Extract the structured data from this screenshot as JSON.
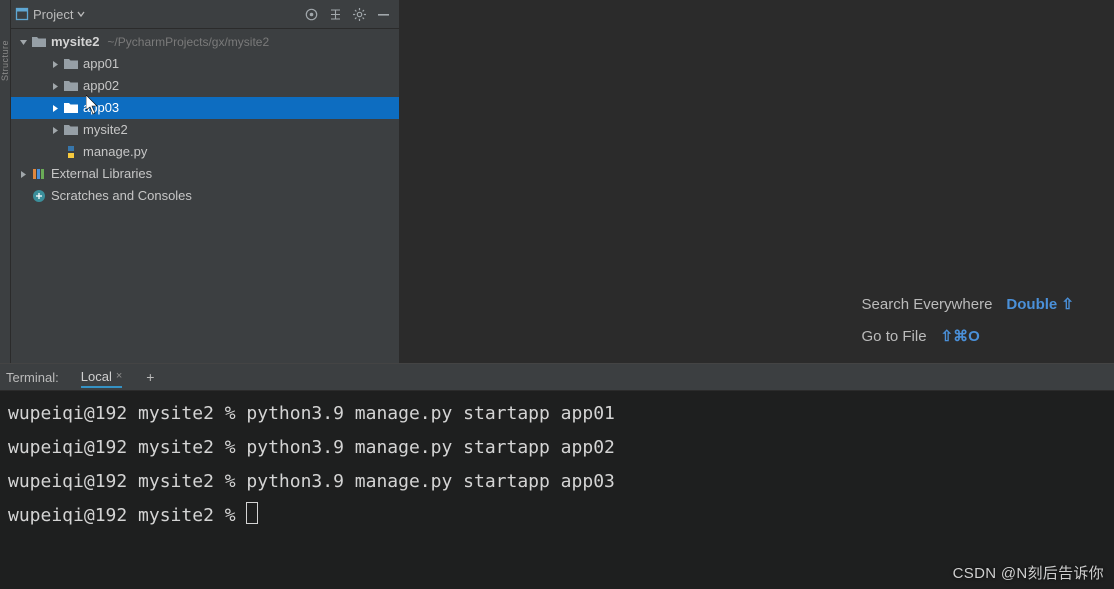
{
  "project_panel": {
    "title": "Project",
    "toolbar_icons": [
      "target-icon",
      "filter-icon",
      "gear-icon",
      "minimize-icon"
    ]
  },
  "tree": {
    "root": {
      "label": "mysite2",
      "path": "~/PycharmProjects/gx/mysite2"
    },
    "items": [
      {
        "label": "app01",
        "icon": "folder",
        "indent": 2,
        "selected": false,
        "chevron": "right"
      },
      {
        "label": "app02",
        "icon": "folder",
        "indent": 2,
        "selected": false,
        "chevron": "right"
      },
      {
        "label": "app03",
        "icon": "folder",
        "indent": 2,
        "selected": true,
        "chevron": "right"
      },
      {
        "label": "mysite2",
        "icon": "folder",
        "indent": 2,
        "selected": false,
        "chevron": "right"
      },
      {
        "label": "manage.py",
        "icon": "pyfile",
        "indent": 2,
        "selected": false,
        "chevron": ""
      }
    ],
    "external_libraries": "External Libraries",
    "scratches": "Scratches and Consoles"
  },
  "sidebar_strip": {
    "structure": "Structure"
  },
  "hints": [
    {
      "label": "Search Everywhere",
      "shortcut": "Double ⇧"
    },
    {
      "label": "Go to File",
      "shortcut": "⇧⌘O"
    }
  ],
  "terminal": {
    "title": "Terminal:",
    "tab": "Local",
    "lines": [
      "wupeiqi@192 mysite2 % python3.9 manage.py startapp app01",
      "wupeiqi@192 mysite2 % python3.9 manage.py startapp app02",
      "wupeiqi@192 mysite2 % python3.9 manage.py startapp app03",
      "wupeiqi@192 mysite2 % "
    ]
  },
  "watermark": "CSDN @N刻后告诉你"
}
